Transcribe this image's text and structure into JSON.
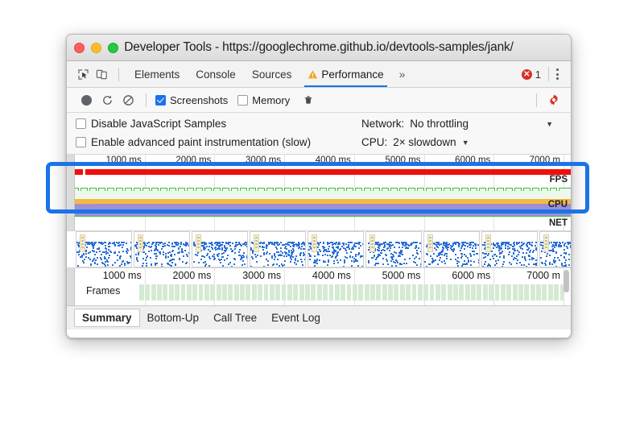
{
  "window": {
    "title": "Developer Tools - https://googlechrome.github.io/devtools-samples/jank/",
    "traffic_lights": [
      "close",
      "minimize",
      "zoom"
    ]
  },
  "tabbar": {
    "inspect_icon": "inspect-element-icon",
    "device_icon": "device-toolbar-icon",
    "tabs": [
      {
        "label": "Elements",
        "active": false,
        "warning": false
      },
      {
        "label": "Console",
        "active": false,
        "warning": false
      },
      {
        "label": "Sources",
        "active": false,
        "warning": false
      },
      {
        "label": "Performance",
        "active": true,
        "warning": true
      }
    ],
    "more_tabs": "»",
    "error_count": "1",
    "error_icon": "error-circle-icon",
    "menu_icon": "kebab-menu-icon"
  },
  "rec_toolbar": {
    "record_icon": "record-circle-icon",
    "reload_icon": "reload-and-record-icon",
    "clear_icon": "clear-recording-icon",
    "screenshots": {
      "label": "Screenshots",
      "checked": true
    },
    "memory": {
      "label": "Memory",
      "checked": false
    },
    "trash_icon": "trash-icon",
    "settings_icon": "gear-icon",
    "settings_color": "#d93025"
  },
  "settings": {
    "rows": [
      {
        "checkbox_label": "Disable JavaScript Samples",
        "checked": false,
        "select_label": "Network:",
        "select_value": "No throttling",
        "caret": "▼",
        "caret_far": true
      },
      {
        "checkbox_label": "Enable advanced paint instrumentation (slow)",
        "checked": false,
        "select_label": "CPU:",
        "select_value": "2× slowdown",
        "caret": "▼",
        "caret_far": false
      }
    ]
  },
  "overview": {
    "ruler_labels": [
      "1000 ms",
      "2000 ms",
      "3000 ms",
      "4000 ms",
      "5000 ms",
      "6000 ms",
      "7000 m"
    ],
    "track_labels": {
      "fps": "FPS",
      "cpu": "CPU",
      "net": "NET"
    },
    "colors": {
      "jank_bar": "#f20d0d",
      "fps_line": "#3fbf3f",
      "cpu": "#f5b942",
      "memory": "#9d8fd6",
      "highlight": "#1a73e8"
    }
  },
  "bottom_ruler": {
    "labels": [
      "1000 ms",
      "2000 ms",
      "3000 ms",
      "4000 ms",
      "5000 ms",
      "6000 ms",
      "7000 m"
    ],
    "frames_label": "Frames"
  },
  "bottom_tabs": [
    {
      "label": "Summary",
      "active": true
    },
    {
      "label": "Bottom-Up",
      "active": false
    },
    {
      "label": "Call Tree",
      "active": false
    },
    {
      "label": "Event Log",
      "active": false
    }
  ],
  "annotation": {
    "highlight_target": "timeline-overview-pane"
  }
}
